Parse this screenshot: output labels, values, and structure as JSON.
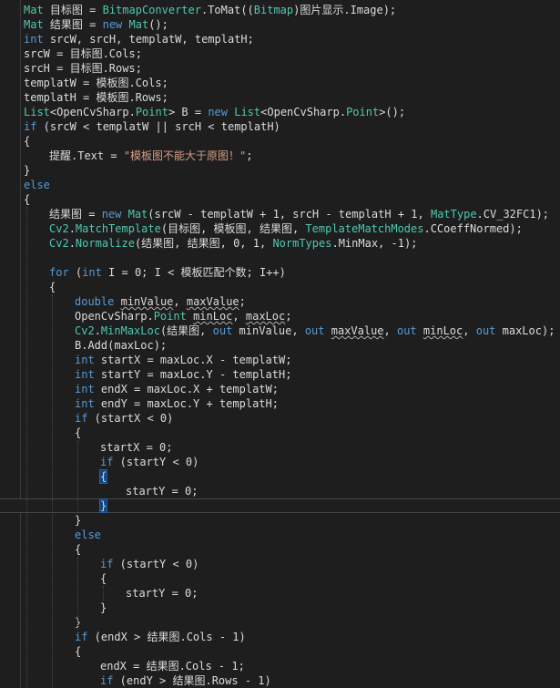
{
  "editor": {
    "lines": [
      {
        "indent": 0,
        "tokens": [
          {
            "t": "Mat",
            "c": "type"
          },
          {
            "t": " 目标图 = ",
            "c": "id"
          },
          {
            "t": "BitmapConverter",
            "c": "type"
          },
          {
            "t": ".ToMat((",
            "c": "id"
          },
          {
            "t": "Bitmap",
            "c": "type"
          },
          {
            "t": ")图片显示.Image);",
            "c": "id"
          }
        ]
      },
      {
        "indent": 0,
        "tokens": [
          {
            "t": "Mat",
            "c": "type"
          },
          {
            "t": " 结果图 = ",
            "c": "id"
          },
          {
            "t": "new",
            "c": "kw"
          },
          {
            "t": " ",
            "c": "id"
          },
          {
            "t": "Mat",
            "c": "type"
          },
          {
            "t": "();",
            "c": "id"
          }
        ]
      },
      {
        "indent": 0,
        "tokens": [
          {
            "t": "int",
            "c": "kw"
          },
          {
            "t": " srcW, srcH, templatW, templatH;",
            "c": "id"
          }
        ]
      },
      {
        "indent": 0,
        "tokens": [
          {
            "t": "srcW = 目标图.Cols;",
            "c": "id"
          }
        ]
      },
      {
        "indent": 0,
        "tokens": [
          {
            "t": "srcH = 目标图.Rows;",
            "c": "id"
          }
        ]
      },
      {
        "indent": 0,
        "tokens": [
          {
            "t": "templatW = 模板图.Cols;",
            "c": "id"
          }
        ]
      },
      {
        "indent": 0,
        "tokens": [
          {
            "t": "templatH = 模板图.Rows;",
            "c": "id"
          }
        ]
      },
      {
        "indent": 0,
        "tokens": [
          {
            "t": "List",
            "c": "type"
          },
          {
            "t": "<OpenCvSharp.",
            "c": "id"
          },
          {
            "t": "Point",
            "c": "type"
          },
          {
            "t": "> B = ",
            "c": "id"
          },
          {
            "t": "new",
            "c": "kw"
          },
          {
            "t": " ",
            "c": "id"
          },
          {
            "t": "List",
            "c": "type"
          },
          {
            "t": "<OpenCvSharp.",
            "c": "id"
          },
          {
            "t": "Point",
            "c": "type"
          },
          {
            "t": ">();",
            "c": "id"
          }
        ]
      },
      {
        "indent": 0,
        "tokens": [
          {
            "t": "if",
            "c": "kw"
          },
          {
            "t": " (srcW < templatW || srcH < templatH)",
            "c": "id"
          }
        ]
      },
      {
        "indent": 0,
        "tokens": [
          {
            "t": "{",
            "c": "id"
          }
        ]
      },
      {
        "indent": 1,
        "tokens": [
          {
            "t": "提醒.Text = ",
            "c": "id"
          },
          {
            "t": "\"模板图不能大于原图！\"",
            "c": "str"
          },
          {
            "t": ";",
            "c": "id"
          }
        ]
      },
      {
        "indent": 0,
        "tokens": [
          {
            "t": "}",
            "c": "id"
          }
        ]
      },
      {
        "indent": 0,
        "tokens": [
          {
            "t": "else",
            "c": "kw"
          }
        ]
      },
      {
        "indent": 0,
        "tokens": [
          {
            "t": "{",
            "c": "id"
          }
        ]
      },
      {
        "indent": 1,
        "tokens": [
          {
            "t": "结果图 = ",
            "c": "id"
          },
          {
            "t": "new",
            "c": "kw"
          },
          {
            "t": " ",
            "c": "id"
          },
          {
            "t": "Mat",
            "c": "type"
          },
          {
            "t": "(srcW - templatW + 1, srcH - templatH + 1, ",
            "c": "id"
          },
          {
            "t": "MatType",
            "c": "type"
          },
          {
            "t": ".CV_32FC1);",
            "c": "id"
          }
        ]
      },
      {
        "indent": 1,
        "tokens": [
          {
            "t": "Cv2",
            "c": "type"
          },
          {
            "t": ".",
            "c": "id"
          },
          {
            "t": "MatchTemplate",
            "c": "type"
          },
          {
            "t": "(目标图, 模板图, 结果图, ",
            "c": "id"
          },
          {
            "t": "TemplateMatchModes",
            "c": "type"
          },
          {
            "t": ".CCoeffNormed);",
            "c": "id"
          }
        ]
      },
      {
        "indent": 1,
        "tokens": [
          {
            "t": "Cv2",
            "c": "type"
          },
          {
            "t": ".",
            "c": "id"
          },
          {
            "t": "Normalize",
            "c": "type"
          },
          {
            "t": "(结果图, 结果图, 0, 1, ",
            "c": "id"
          },
          {
            "t": "NormTypes",
            "c": "type"
          },
          {
            "t": ".MinMax, -1);",
            "c": "id"
          }
        ]
      },
      {
        "indent": 0,
        "tokens": []
      },
      {
        "indent": 1,
        "tokens": [
          {
            "t": "for",
            "c": "kw"
          },
          {
            "t": " (",
            "c": "id"
          },
          {
            "t": "int",
            "c": "kw"
          },
          {
            "t": " I = 0; I < 模板匹配个数; I++)",
            "c": "id"
          }
        ]
      },
      {
        "indent": 1,
        "tokens": [
          {
            "t": "{",
            "c": "id"
          }
        ]
      },
      {
        "indent": 2,
        "tokens": [
          {
            "t": "double",
            "c": "kw"
          },
          {
            "t": " ",
            "c": "id"
          },
          {
            "t": "minValue",
            "c": "warn"
          },
          {
            "t": ", ",
            "c": "id"
          },
          {
            "t": "maxValue",
            "c": "warn"
          },
          {
            "t": ";",
            "c": "id"
          }
        ]
      },
      {
        "indent": 2,
        "tokens": [
          {
            "t": "OpenCvSharp.",
            "c": "id"
          },
          {
            "t": "Point",
            "c": "type"
          },
          {
            "t": " ",
            "c": "id"
          },
          {
            "t": "minLoc",
            "c": "warn"
          },
          {
            "t": ", ",
            "c": "id"
          },
          {
            "t": "maxLoc",
            "c": "warn"
          },
          {
            "t": ";",
            "c": "id"
          }
        ]
      },
      {
        "indent": 2,
        "tokens": [
          {
            "t": "Cv2",
            "c": "type"
          },
          {
            "t": ".",
            "c": "id"
          },
          {
            "t": "MinMaxLoc",
            "c": "type"
          },
          {
            "t": "(结果图, ",
            "c": "id"
          },
          {
            "t": "out",
            "c": "kw"
          },
          {
            "t": " minValue, ",
            "c": "id"
          },
          {
            "t": "out",
            "c": "kw"
          },
          {
            "t": " ",
            "c": "id"
          },
          {
            "t": "maxValue",
            "c": "warn"
          },
          {
            "t": ", ",
            "c": "id"
          },
          {
            "t": "out",
            "c": "kw"
          },
          {
            "t": " ",
            "c": "id"
          },
          {
            "t": "minLoc",
            "c": "warn"
          },
          {
            "t": ", ",
            "c": "id"
          },
          {
            "t": "out",
            "c": "kw"
          },
          {
            "t": " maxLoc);",
            "c": "id"
          }
        ]
      },
      {
        "indent": 2,
        "tokens": [
          {
            "t": "B.Add(maxLoc);",
            "c": "id"
          }
        ]
      },
      {
        "indent": 2,
        "tokens": [
          {
            "t": "int",
            "c": "kw"
          },
          {
            "t": " startX = maxLoc.X - templatW;",
            "c": "id"
          }
        ]
      },
      {
        "indent": 2,
        "tokens": [
          {
            "t": "int",
            "c": "kw"
          },
          {
            "t": " startY = maxLoc.Y - templatH;",
            "c": "id"
          }
        ]
      },
      {
        "indent": 2,
        "tokens": [
          {
            "t": "int",
            "c": "kw"
          },
          {
            "t": " endX = maxLoc.X + templatW;",
            "c": "id"
          }
        ]
      },
      {
        "indent": 2,
        "tokens": [
          {
            "t": "int",
            "c": "kw"
          },
          {
            "t": " endY = maxLoc.Y + templatH;",
            "c": "id"
          }
        ]
      },
      {
        "indent": 2,
        "tokens": [
          {
            "t": "if",
            "c": "kw"
          },
          {
            "t": " (startX < 0)",
            "c": "id"
          }
        ]
      },
      {
        "indent": 2,
        "tokens": [
          {
            "t": "{",
            "c": "id"
          }
        ]
      },
      {
        "indent": 3,
        "tokens": [
          {
            "t": "startX = 0;",
            "c": "id"
          }
        ]
      },
      {
        "indent": 3,
        "tokens": [
          {
            "t": "if",
            "c": "kw"
          },
          {
            "t": " (startY < 0)",
            "c": "id"
          }
        ]
      },
      {
        "indent": 3,
        "tokens": [
          {
            "t": "{",
            "c": "brace"
          }
        ]
      },
      {
        "indent": 4,
        "tokens": [
          {
            "t": "startY = 0;",
            "c": "id"
          }
        ]
      },
      {
        "indent": 3,
        "current": true,
        "tokens": [
          {
            "t": "}",
            "c": "brace"
          }
        ]
      },
      {
        "indent": 2,
        "tokens": [
          {
            "t": "}",
            "c": "id"
          }
        ]
      },
      {
        "indent": 2,
        "tokens": [
          {
            "t": "else",
            "c": "kw"
          }
        ]
      },
      {
        "indent": 2,
        "tokens": [
          {
            "t": "{",
            "c": "id"
          }
        ]
      },
      {
        "indent": 3,
        "tokens": [
          {
            "t": "if",
            "c": "kw"
          },
          {
            "t": " (startY < 0)",
            "c": "id"
          }
        ]
      },
      {
        "indent": 3,
        "tokens": [
          {
            "t": "{",
            "c": "id"
          }
        ]
      },
      {
        "indent": 4,
        "tokens": [
          {
            "t": "startY = 0;",
            "c": "id"
          }
        ]
      },
      {
        "indent": 3,
        "tokens": [
          {
            "t": "}",
            "c": "id"
          }
        ]
      },
      {
        "indent": 2,
        "tokens": [
          {
            "t": "}",
            "c": "id"
          }
        ]
      },
      {
        "indent": 2,
        "tokens": [
          {
            "t": "if",
            "c": "kw"
          },
          {
            "t": " (endX > 结果图.Cols - 1)",
            "c": "id"
          }
        ]
      },
      {
        "indent": 2,
        "tokens": [
          {
            "t": "{",
            "c": "id"
          }
        ]
      },
      {
        "indent": 3,
        "tokens": [
          {
            "t": "endX = 结果图.Cols - 1;",
            "c": "id"
          }
        ]
      },
      {
        "indent": 3,
        "tokens": [
          {
            "t": "if",
            "c": "kw"
          },
          {
            "t": " (endY > 结果图.Rows - 1)",
            "c": "id"
          }
        ]
      }
    ]
  },
  "colors": {
    "background": "#1e1e1e",
    "keyword": "#569cd6",
    "type": "#4ec9b0",
    "identifier": "#dcdcdc",
    "string": "#d69d85",
    "brace_highlight": "#0e4583"
  }
}
